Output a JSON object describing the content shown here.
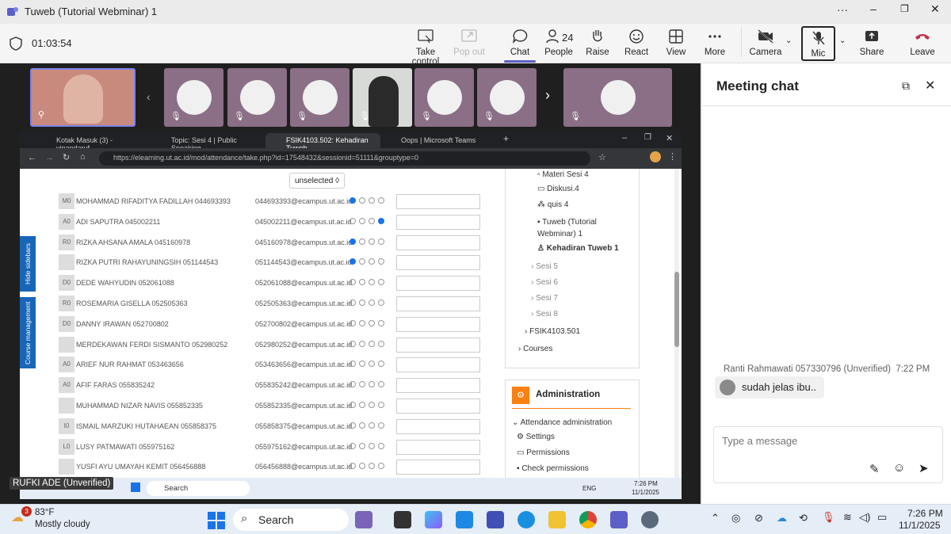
{
  "window": {
    "title": "Tuweb (Tutorial Webminar) 1"
  },
  "meeting": {
    "timer": "01:03:54",
    "toolbar": [
      {
        "label": "Take control",
        "icon": "take-control-icon",
        "enabled": true
      },
      {
        "label": "Pop out",
        "icon": "pop-out-icon",
        "enabled": false
      },
      {
        "label": "Chat",
        "icon": "chat-icon",
        "enabled": true,
        "selected": true
      },
      {
        "label": "People",
        "icon": "people-icon",
        "count": "24",
        "enabled": true
      },
      {
        "label": "Raise",
        "icon": "raise-hand-icon",
        "enabled": true
      },
      {
        "label": "React",
        "icon": "react-icon",
        "enabled": true
      },
      {
        "label": "View",
        "icon": "view-icon",
        "enabled": true
      },
      {
        "label": "More",
        "icon": "more-icon",
        "enabled": true
      },
      {
        "label": "Camera",
        "icon": "camera-off-icon",
        "enabled": true
      },
      {
        "label": "Mic",
        "icon": "mic-off-icon",
        "enabled": true
      },
      {
        "label": "Share",
        "icon": "share-icon",
        "enabled": true
      },
      {
        "label": "Leave",
        "icon": "leave-icon",
        "enabled": true
      }
    ],
    "presenter_label": "RUFKI ADE (Unverified)"
  },
  "browser": {
    "tabs": [
      {
        "label": "Kotak Masuk (3) - vinandaruf..."
      },
      {
        "label": "Topic: Sesi 4 | Public Speaking"
      },
      {
        "label": "FSIK4103.502: Kehadiran Tuweb"
      },
      {
        "label": "Oops | Microsoft Teams"
      }
    ],
    "url": "https://elearning.ut.ac.id/mod/attendance/take.php?id=17548432&sessionid=51111&grouptype=0"
  },
  "attendance": {
    "filter_label": "unselected",
    "rows": [
      {
        "initials": "M0",
        "name": "MOHAMMAD RIFADITYA FADILLAH 044693393",
        "email": "044693393@ecampus.ut.ac.id",
        "selected": 0
      },
      {
        "initials": "A0",
        "name": "ADI SAPUTRA 045002211",
        "email": "045002211@ecampus.ut.ac.id",
        "selected": 3
      },
      {
        "initials": "R0",
        "name": "RIZKA AHSANA AMALA 045160978",
        "email": "045160978@ecampus.ut.ac.id",
        "selected": 0
      },
      {
        "initials": "",
        "name": "RIZKA PUTRI RAHAYUNINGSIH 051144543",
        "email": "051144543@ecampus.ut.ac.id",
        "selected": 0
      },
      {
        "initials": "D0",
        "name": "DEDE WAHYUDIN 052061088",
        "email": "052061088@ecampus.ut.ac.id",
        "selected": -1
      },
      {
        "initials": "R0",
        "name": "ROSEMARIA GISELLA 052505363",
        "email": "052505363@ecampus.ut.ac.id",
        "selected": -1
      },
      {
        "initials": "D0",
        "name": "DANNY IRAWAN 052700802",
        "email": "052700802@ecampus.ut.ac.id",
        "selected": -1
      },
      {
        "initials": "",
        "name": "MERDEKAWAN FERDI SISMANTO 052980252",
        "email": "052980252@ecampus.ut.ac.id",
        "selected": -1
      },
      {
        "initials": "A0",
        "name": "ARIEF NUR RAHMAT 053463656",
        "email": "053463656@ecampus.ut.ac.id",
        "selected": -1
      },
      {
        "initials": "A0",
        "name": "AFIF FARAS 055835242",
        "email": "055835242@ecampus.ut.ac.id",
        "selected": -1
      },
      {
        "initials": "",
        "name": "MUHAMMAD NIZAR NAVIS 055852335",
        "email": "055852335@ecampus.ut.ac.id",
        "selected": -1
      },
      {
        "initials": "I0",
        "name": "ISMAIL MARZUKI HUTAHAEAN 055858375",
        "email": "055858375@ecampus.ut.ac.id",
        "selected": -1
      },
      {
        "initials": "L0",
        "name": "LUSY PATMAWATI 055975162",
        "email": "055975162@ecampus.ut.ac.id",
        "selected": -1
      },
      {
        "initials": "",
        "name": "YUSFI AYU UMAYAH KEMIT 056456888",
        "email": "056456888@ecampus.ut.ac.id",
        "selected": -1
      }
    ],
    "side_tabs": [
      "Hide sidebars",
      "Course management"
    ]
  },
  "course_nav": {
    "items": [
      "Materi Sesi 4",
      "Diskusi.4",
      "quis 4",
      "Tuweb (Tutorial Webminar) 1",
      "Kehadiran Tuweb 1",
      "Sesi 5",
      "Sesi 6",
      "Sesi 7",
      "Sesi 8",
      "FSIK4103.501",
      "Courses"
    ],
    "admin_title": "Administration",
    "admin_items": [
      "Attendance administration",
      "Settings",
      "Permissions",
      "Check permissions"
    ]
  },
  "inner_taskbar": {
    "search": "Search",
    "lang": "ENG",
    "time": "7:26 PM",
    "date": "11/1/2025"
  },
  "chat": {
    "title": "Meeting chat",
    "messages": [
      {
        "sender": "Ranti Rahmawati 057330796 (Unverified)",
        "time": "7:22 PM",
        "text": "sudah jelas ibu.."
      }
    ],
    "composer_placeholder": "Type a message"
  },
  "taskbar": {
    "weather_temp": "83°F",
    "weather_desc": "Mostly cloudy",
    "weather_badge": "3",
    "search_label": "Search",
    "time": "7:26 PM",
    "date": "11/1/2025"
  },
  "colors": {
    "accent": "#5b5fc7",
    "leave": "#c4314b",
    "moodle_blue": "#1866b8",
    "admin_orange": "#f98012"
  }
}
